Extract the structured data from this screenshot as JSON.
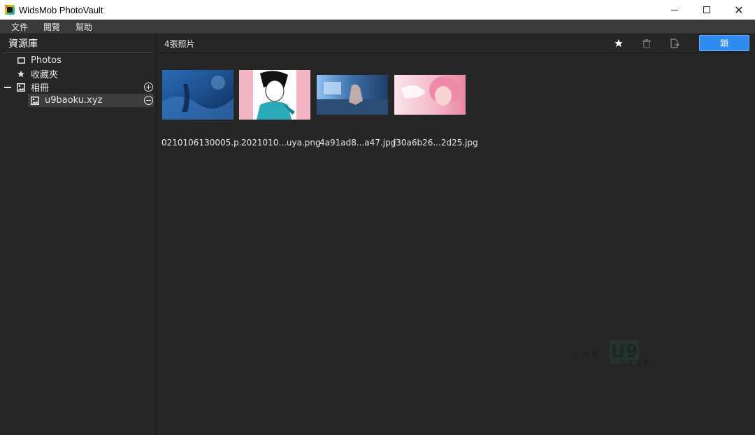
{
  "window": {
    "title": "WidsMob PhotoVault",
    "minimize": "minimize",
    "maximize": "maximize",
    "close": "✕"
  },
  "menu": {
    "items": [
      "文件",
      "閱覽",
      "幫助"
    ]
  },
  "sidebar": {
    "header": "資源庫",
    "items": [
      {
        "label": "Photos",
        "icon": "photo-frame-icon"
      },
      {
        "label": "收藏夾",
        "icon": "star-icon"
      },
      {
        "label": "相冊",
        "icon": "album-icon",
        "expand": "−"
      },
      {
        "label": "u9baoku.xyz",
        "icon": "album-icon",
        "selected": true
      }
    ]
  },
  "main": {
    "photo_count": "4張照片",
    "lock_button": "鎖",
    "photos": [
      {
        "caption": "0210106130005.p...",
        "colors": [
          "#1d4f8c",
          "#3a7cc4",
          "#0f2c5a"
        ]
      },
      {
        "caption": "2021010...uya.png",
        "colors": [
          "#f29bb0",
          "#ffffff",
          "#2aa9b8"
        ]
      },
      {
        "caption": "4a91ad8...a47.jpg",
        "colors": [
          "#6aa8e6",
          "#2a4f7c",
          "#c9d9f0"
        ]
      },
      {
        "caption": "f30a6b26...2d25.jpg",
        "colors": [
          "#f3a9c3",
          "#e9879f",
          "#fbe4ea"
        ]
      }
    ]
  },
  "watermark": {
    "left_text": "公众号:",
    "logo": "U9",
    "sub_text": "软件宝库"
  }
}
